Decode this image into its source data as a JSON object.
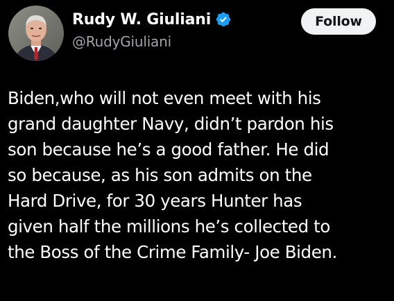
{
  "author": {
    "display_name": "Rudy W. Giuliani",
    "handle": "@RudyGiuliani",
    "verified": true,
    "avatar_icon": "profile-photo"
  },
  "follow_button": {
    "label": "Follow"
  },
  "tweet": {
    "lines": [
      "Biden,who will not even meet with his",
      "grand daughter Navy, didn’t pardon his",
      "son because he’s a good father. He did",
      "so because, as his son admits on the",
      "Hard Drive, for 30 years Hunter has",
      "given half the millions he’s collected to",
      "the Boss of the Crime Family- Joe Biden."
    ]
  },
  "colors": {
    "background": "#000000",
    "text": "#ffffff",
    "handle": "#a1a5aa",
    "verified_badge": "#1d9bf0",
    "follow_bg": "#eff3f4",
    "follow_text": "#0f1419"
  }
}
